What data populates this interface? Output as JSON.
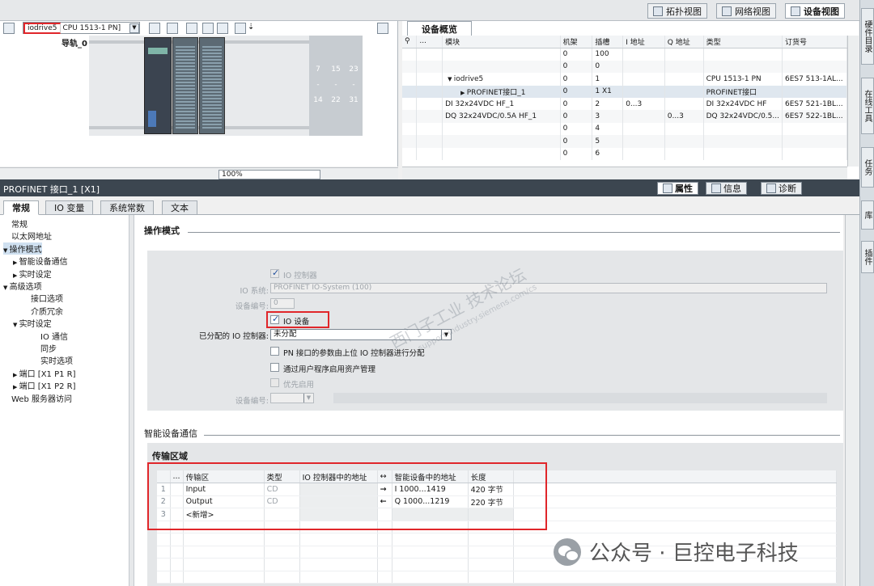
{
  "view_tabs": {
    "topology": "拓扑视图",
    "network": "网络视图",
    "device": "设备视图"
  },
  "device_view": {
    "device_name": "iodrive5",
    "device_type": "CPU 1513-1 PN]",
    "rail_label": "导轨_0",
    "slot_numbers_top": [
      "7",
      "15",
      "23"
    ],
    "slot_numbers_mid": [
      "-",
      "-",
      "-"
    ],
    "slot_numbers_bottom": [
      "14",
      "22",
      "31"
    ],
    "zoom": "100%"
  },
  "overview": {
    "tab_label": "设备概览",
    "columns": [
      "...",
      "模块",
      "机架",
      "插槽",
      "I 地址",
      "Q 地址",
      "类型",
      "订货号"
    ],
    "rows": [
      {
        "module": "",
        "rack": "0",
        "slot": "100",
        "i_addr": "",
        "q_addr": "",
        "type": "",
        "order": ""
      },
      {
        "module": "",
        "rack": "0",
        "slot": "0",
        "i_addr": "",
        "q_addr": "",
        "type": "",
        "order": ""
      },
      {
        "module": "iodrive5",
        "rack": "0",
        "slot": "1",
        "i_addr": "",
        "q_addr": "",
        "type": "CPU 1513-1 PN",
        "order": "6ES7 513-1AL..."
      },
      {
        "module": "PROFINET接口_1",
        "rack": "0",
        "slot": "1 X1",
        "i_addr": "",
        "q_addr": "",
        "type": "PROFINET接口",
        "order": ""
      },
      {
        "module": "DI 32x24VDC HF_1",
        "rack": "0",
        "slot": "2",
        "i_addr": "0...3",
        "q_addr": "",
        "type": "DI 32x24VDC HF",
        "order": "6ES7 521-1BL..."
      },
      {
        "module": "DQ 32x24VDC/0.5A HF_1",
        "rack": "0",
        "slot": "3",
        "i_addr": "",
        "q_addr": "0...3",
        "type": "DQ 32x24VDC/0.5...",
        "order": "6ES7 522-1BL..."
      },
      {
        "module": "",
        "rack": "0",
        "slot": "4",
        "i_addr": "",
        "q_addr": "",
        "type": "",
        "order": ""
      },
      {
        "module": "",
        "rack": "0",
        "slot": "5",
        "i_addr": "",
        "q_addr": "",
        "type": "",
        "order": ""
      },
      {
        "module": "",
        "rack": "0",
        "slot": "6",
        "i_addr": "",
        "q_addr": "",
        "type": "",
        "order": ""
      }
    ]
  },
  "side_tabs": [
    "硬件目录",
    "在线工具",
    "任务",
    "库",
    "插件"
  ],
  "properties": {
    "title": "PROFINET 接口_1 [X1]",
    "buttons": {
      "properties": "属性",
      "info": "信息",
      "diagnostics": "诊断"
    },
    "tabs": [
      "常规",
      "IO 变量",
      "系统常数",
      "文本"
    ]
  },
  "nav_tree": [
    {
      "label": "常规",
      "indent": 0,
      "arrow": ""
    },
    {
      "label": "以太网地址",
      "indent": 0,
      "arrow": ""
    },
    {
      "label": "操作模式",
      "indent": 0,
      "arrow": "▼",
      "selected": true
    },
    {
      "label": "智能设备通信",
      "indent": 1,
      "arrow": "▶"
    },
    {
      "label": "实时设定",
      "indent": 1,
      "arrow": "▶"
    },
    {
      "label": "高级选项",
      "indent": 0,
      "arrow": "▼"
    },
    {
      "label": "接口选项",
      "indent": 2,
      "arrow": ""
    },
    {
      "label": "介质冗余",
      "indent": 2,
      "arrow": ""
    },
    {
      "label": "实时设定",
      "indent": 1,
      "arrow": "▼"
    },
    {
      "label": "IO 通信",
      "indent": 3,
      "arrow": ""
    },
    {
      "label": "同步",
      "indent": 3,
      "arrow": ""
    },
    {
      "label": "实时选项",
      "indent": 3,
      "arrow": ""
    },
    {
      "label": "端口 [X1 P1 R]",
      "indent": 1,
      "arrow": "▶"
    },
    {
      "label": "端口 [X1 P2 R]",
      "indent": 1,
      "arrow": "▶"
    },
    {
      "label": "Web 服务器访问",
      "indent": 0,
      "arrow": ""
    }
  ],
  "operating_mode": {
    "section_title": "操作模式",
    "io_controller_label": "IO 控制器",
    "io_system_label": "IO 系统:",
    "io_system_value": "PROFINET IO-System (100)",
    "device_number_label": "设备编号:",
    "device_number_value": "0",
    "io_device_label": "IO 设备",
    "assigned_controller_label": "已分配的 IO 控制器:",
    "assigned_controller_value": "未分配",
    "pn_param_label": "PN 接口的参数由上位 IO 控制器进行分配",
    "asset_mgmt_label": "通过用户程序启用资产管理",
    "priority_label": "优先启用",
    "device_number2_label": "设备编号:"
  },
  "smart_device": {
    "section_title": "智能设备通信",
    "transfer_area_title": "传输区域",
    "columns": [
      "...",
      "传输区",
      "类型",
      "IO 控制器中的地址",
      "↔",
      "智能设备中的地址",
      "长度"
    ],
    "rows": [
      {
        "idx": "1",
        "name": "Input",
        "type": "CD",
        "ctrl_addr": "",
        "dir": "→",
        "dev_addr": "I 1000...1419",
        "length": "420 字节"
      },
      {
        "idx": "2",
        "name": "Output",
        "type": "CD",
        "ctrl_addr": "",
        "dir": "←",
        "dev_addr": "Q 1000...1219",
        "length": "220 字节"
      },
      {
        "idx": "3",
        "name": "<新增>",
        "type": "",
        "ctrl_addr": "",
        "dir": "",
        "dev_addr": "",
        "length": ""
      }
    ]
  },
  "watermark": {
    "main": "西门子工业 技术论坛",
    "sub": "support.industry.siemens.com/cs"
  },
  "footer_brand": "公众号 · 巨控电子科技"
}
